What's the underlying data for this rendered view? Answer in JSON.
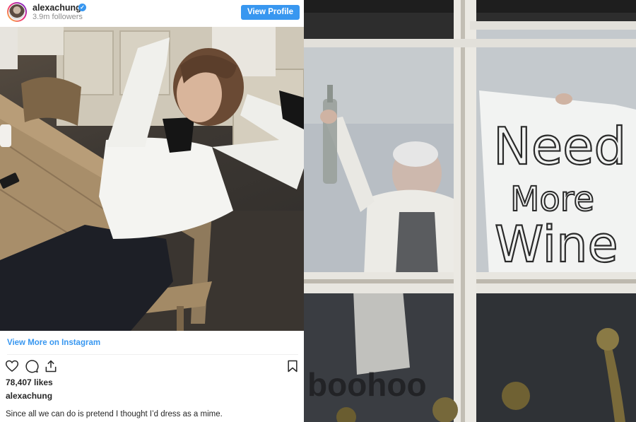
{
  "embed": {
    "username": "alexachung",
    "followers": "3.9m followers",
    "view_profile_label": "View Profile",
    "view_more_label": "View More on Instagram",
    "likes": "78,407 likes",
    "caption_username": "alexachung",
    "caption": "Since all we can do is pretend I thought I’d dress as a mime.",
    "accent_color": "#3897f0",
    "icons": [
      "heart-icon",
      "comment-icon",
      "share-icon",
      "bookmark-icon"
    ]
  },
  "window_photo": {
    "sign_lines": [
      "Need",
      "More",
      "Wine"
    ],
    "storefront_text": "boohoo"
  }
}
